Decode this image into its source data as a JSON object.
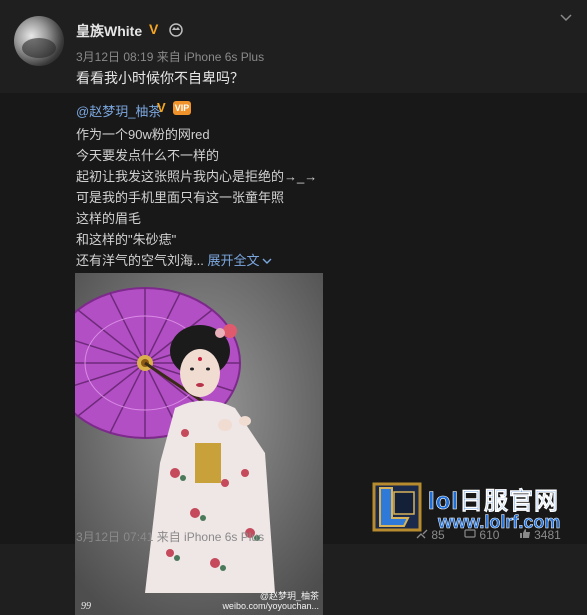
{
  "post": {
    "author": "皇族White",
    "verified_mark": "V",
    "meta": "3月12日 08:19 来自 iPhone 6s Plus",
    "text": "看看我小时候你不自卑吗？"
  },
  "repost": {
    "author": "@赵梦玥_柚茶",
    "verified_mark": "V",
    "badge": "VIP",
    "lines": [
      "作为一个90w粉的网red",
      "今天要发点什么不一样的",
      "起初让我发这张照片我内心是拒绝的→_→",
      "可是我的手机里面只有这一张童年照",
      "这样的眉毛",
      "和这样的\"朱砂痣\"",
      "还有洋气的空气刘海..."
    ],
    "expand_label": "展开全文",
    "photo_watermark_line1": "@赵梦玥_柚茶",
    "photo_watermark_line2": "weibo.com/yoyouchan...",
    "photo_corner_mark": "99",
    "time": "3月12日 07:41 来自 iPhone 6s Plus",
    "stats": {
      "repost_count": "85",
      "comment_count": "610",
      "like_count": "3481"
    }
  },
  "watermark": {
    "site_name": "lol日服官网",
    "site_url": "www.lolrf.com"
  },
  "colors": {
    "link": "#7ba7e0",
    "vip": "#f5a623",
    "site": "#1e6fd9"
  },
  "icons": [
    "crown-icon",
    "chevron-down-icon",
    "repost-icon",
    "comment-icon",
    "like-icon",
    "league-logo-icon"
  ]
}
